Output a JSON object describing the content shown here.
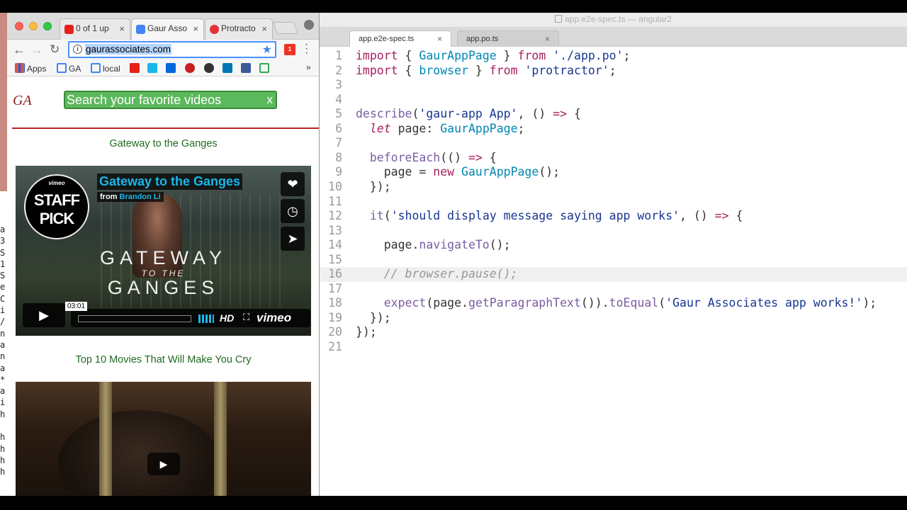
{
  "browser": {
    "tabs": [
      {
        "label": "0 of 1 up",
        "favicon": "youtube-icon",
        "color": "#e62117"
      },
      {
        "label": "Gaur Asso",
        "favicon": "google-g-icon",
        "color": "#4285f4"
      },
      {
        "label": "Protracto",
        "favicon": "protractor-icon",
        "color": "#e23237"
      }
    ],
    "url": "gaurassociates.com",
    "bookmarks": [
      {
        "label": "Apps",
        "icon": "apps-grid-icon"
      },
      {
        "label": "GA",
        "icon": "google-g-icon"
      },
      {
        "label": "local",
        "icon": "google-g-icon"
      },
      {
        "label": "",
        "icon": "youtube-icon"
      },
      {
        "label": "",
        "icon": "vimeo-icon"
      },
      {
        "label": "",
        "icon": "dailymotion-icon"
      },
      {
        "label": "",
        "icon": "r-icon"
      },
      {
        "label": "",
        "icon": "amazon-icon"
      },
      {
        "label": "",
        "icon": "linkedin-icon"
      },
      {
        "label": "",
        "icon": "facebook-icon"
      },
      {
        "label": "",
        "icon": "google-icon"
      }
    ],
    "overflow": "»",
    "ext_badge": "1"
  },
  "page": {
    "logo": "GA",
    "search_placeholder": "Search your favorite videos",
    "search_clear": "x",
    "videos": [
      {
        "title": "Gateway to the Ganges",
        "player_title": "Gateway to the Ganges",
        "byline_prefix": "from",
        "author": "Brandon Li",
        "badge_brand": "vimeo",
        "badge_line1": "STAFF",
        "badge_line2": "PICK",
        "overlay_line1": "GATEWAY",
        "overlay_line2": "TO THE",
        "overlay_line3": "GANGES",
        "time": "03:01",
        "hd": "HD",
        "brand": "vimeo"
      },
      {
        "title": "Top 10 Movies That Will Make You Cry"
      }
    ]
  },
  "editor": {
    "window_title": "app.e2e-spec.ts — angular2",
    "tabs": [
      {
        "label": "app.e2e-spec.ts",
        "close": "×"
      },
      {
        "label": "app.po.ts",
        "close": "×"
      }
    ],
    "current_line": 16,
    "lines": [
      "import { GaurAppPage } from './app.po';",
      "import { browser } from 'protractor';",
      "",
      "",
      "describe('gaur-app App', () => {",
      "  let page: GaurAppPage;",
      "",
      "  beforeEach(() => {",
      "    page = new GaurAppPage();",
      "  });",
      "",
      "  it('should display message saying app works', () => {",
      "",
      "    page.navigateTo();",
      "",
      "    // browser.pause();",
      "",
      "    expect(page.getParagraphText()).toEqual('Gaur Associates app works!');",
      "  });",
      "});",
      ""
    ]
  },
  "background_terminal": {
    "chars": [
      "a",
      "3",
      "S",
      "1",
      "S",
      "e",
      "C",
      "i",
      "/",
      "n",
      "a",
      "n",
      "a",
      "*",
      "a",
      "i",
      "h",
      "",
      "h",
      "h",
      "h",
      "h"
    ]
  }
}
